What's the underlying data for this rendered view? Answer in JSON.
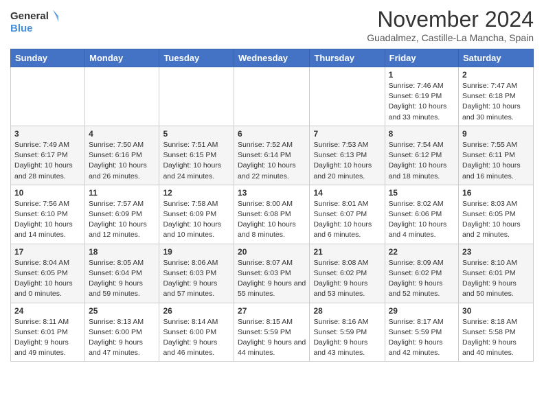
{
  "logo": {
    "line1": "General",
    "line2": "Blue"
  },
  "title": "November 2024",
  "subtitle": "Guadalmez, Castille-La Mancha, Spain",
  "days_of_week": [
    "Sunday",
    "Monday",
    "Tuesday",
    "Wednesday",
    "Thursday",
    "Friday",
    "Saturday"
  ],
  "weeks": [
    [
      {
        "day": "",
        "info": ""
      },
      {
        "day": "",
        "info": ""
      },
      {
        "day": "",
        "info": ""
      },
      {
        "day": "",
        "info": ""
      },
      {
        "day": "",
        "info": ""
      },
      {
        "day": "1",
        "info": "Sunrise: 7:46 AM\nSunset: 6:19 PM\nDaylight: 10 hours and 33 minutes."
      },
      {
        "day": "2",
        "info": "Sunrise: 7:47 AM\nSunset: 6:18 PM\nDaylight: 10 hours and 30 minutes."
      }
    ],
    [
      {
        "day": "3",
        "info": "Sunrise: 7:49 AM\nSunset: 6:17 PM\nDaylight: 10 hours and 28 minutes."
      },
      {
        "day": "4",
        "info": "Sunrise: 7:50 AM\nSunset: 6:16 PM\nDaylight: 10 hours and 26 minutes."
      },
      {
        "day": "5",
        "info": "Sunrise: 7:51 AM\nSunset: 6:15 PM\nDaylight: 10 hours and 24 minutes."
      },
      {
        "day": "6",
        "info": "Sunrise: 7:52 AM\nSunset: 6:14 PM\nDaylight: 10 hours and 22 minutes."
      },
      {
        "day": "7",
        "info": "Sunrise: 7:53 AM\nSunset: 6:13 PM\nDaylight: 10 hours and 20 minutes."
      },
      {
        "day": "8",
        "info": "Sunrise: 7:54 AM\nSunset: 6:12 PM\nDaylight: 10 hours and 18 minutes."
      },
      {
        "day": "9",
        "info": "Sunrise: 7:55 AM\nSunset: 6:11 PM\nDaylight: 10 hours and 16 minutes."
      }
    ],
    [
      {
        "day": "10",
        "info": "Sunrise: 7:56 AM\nSunset: 6:10 PM\nDaylight: 10 hours and 14 minutes."
      },
      {
        "day": "11",
        "info": "Sunrise: 7:57 AM\nSunset: 6:09 PM\nDaylight: 10 hours and 12 minutes."
      },
      {
        "day": "12",
        "info": "Sunrise: 7:58 AM\nSunset: 6:09 PM\nDaylight: 10 hours and 10 minutes."
      },
      {
        "day": "13",
        "info": "Sunrise: 8:00 AM\nSunset: 6:08 PM\nDaylight: 10 hours and 8 minutes."
      },
      {
        "day": "14",
        "info": "Sunrise: 8:01 AM\nSunset: 6:07 PM\nDaylight: 10 hours and 6 minutes."
      },
      {
        "day": "15",
        "info": "Sunrise: 8:02 AM\nSunset: 6:06 PM\nDaylight: 10 hours and 4 minutes."
      },
      {
        "day": "16",
        "info": "Sunrise: 8:03 AM\nSunset: 6:05 PM\nDaylight: 10 hours and 2 minutes."
      }
    ],
    [
      {
        "day": "17",
        "info": "Sunrise: 8:04 AM\nSunset: 6:05 PM\nDaylight: 10 hours and 0 minutes."
      },
      {
        "day": "18",
        "info": "Sunrise: 8:05 AM\nSunset: 6:04 PM\nDaylight: 9 hours and 59 minutes."
      },
      {
        "day": "19",
        "info": "Sunrise: 8:06 AM\nSunset: 6:03 PM\nDaylight: 9 hours and 57 minutes."
      },
      {
        "day": "20",
        "info": "Sunrise: 8:07 AM\nSunset: 6:03 PM\nDaylight: 9 hours and 55 minutes."
      },
      {
        "day": "21",
        "info": "Sunrise: 8:08 AM\nSunset: 6:02 PM\nDaylight: 9 hours and 53 minutes."
      },
      {
        "day": "22",
        "info": "Sunrise: 8:09 AM\nSunset: 6:02 PM\nDaylight: 9 hours and 52 minutes."
      },
      {
        "day": "23",
        "info": "Sunrise: 8:10 AM\nSunset: 6:01 PM\nDaylight: 9 hours and 50 minutes."
      }
    ],
    [
      {
        "day": "24",
        "info": "Sunrise: 8:11 AM\nSunset: 6:01 PM\nDaylight: 9 hours and 49 minutes."
      },
      {
        "day": "25",
        "info": "Sunrise: 8:13 AM\nSunset: 6:00 PM\nDaylight: 9 hours and 47 minutes."
      },
      {
        "day": "26",
        "info": "Sunrise: 8:14 AM\nSunset: 6:00 PM\nDaylight: 9 hours and 46 minutes."
      },
      {
        "day": "27",
        "info": "Sunrise: 8:15 AM\nSunset: 5:59 PM\nDaylight: 9 hours and 44 minutes."
      },
      {
        "day": "28",
        "info": "Sunrise: 8:16 AM\nSunset: 5:59 PM\nDaylight: 9 hours and 43 minutes."
      },
      {
        "day": "29",
        "info": "Sunrise: 8:17 AM\nSunset: 5:59 PM\nDaylight: 9 hours and 42 minutes."
      },
      {
        "day": "30",
        "info": "Sunrise: 8:18 AM\nSunset: 5:58 PM\nDaylight: 9 hours and 40 minutes."
      }
    ]
  ]
}
